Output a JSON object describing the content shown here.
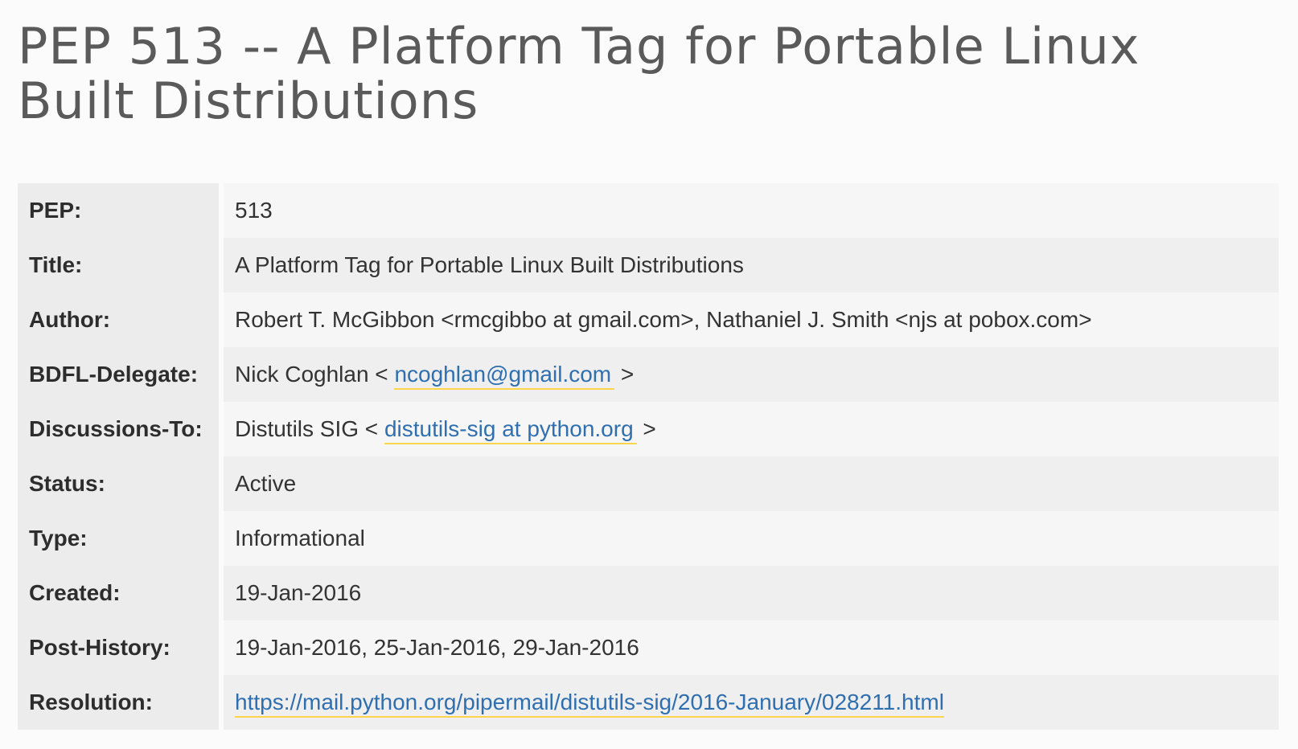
{
  "page": {
    "title": "PEP 513 -- A Platform Tag for Portable Linux Built Distributions"
  },
  "header_table": {
    "pep": {
      "label": "PEP:",
      "value": "513"
    },
    "title": {
      "label": "Title:",
      "value": "A Platform Tag for Portable Linux Built Distributions"
    },
    "author": {
      "label": "Author:",
      "value": "Robert T. McGibbon <rmcgibbo at gmail.com>, Nathaniel J. Smith <njs at pobox.com>"
    },
    "bdfl_delegate": {
      "label": "BDFL-Delegate:",
      "prefix": "Nick Coghlan < ",
      "link_text": "ncoghlan@gmail.com",
      "suffix": " >"
    },
    "discussions_to": {
      "label": "Discussions-To:",
      "prefix": "Distutils SIG < ",
      "link_text": "distutils-sig at python.org",
      "suffix": " >"
    },
    "status": {
      "label": "Status:",
      "value": "Active"
    },
    "type": {
      "label": "Type:",
      "value": "Informational"
    },
    "created": {
      "label": "Created:",
      "value": "19-Jan-2016"
    },
    "post_history": {
      "label": "Post-History:",
      "value": "19-Jan-2016, 25-Jan-2016, 29-Jan-2016"
    },
    "resolution": {
      "label": "Resolution:",
      "link_text": "https://mail.python.org/pipermail/distutils-sig/2016-January/028211.html"
    }
  },
  "colors": {
    "link": "#2f6fb0",
    "link_underline": "#ffd44d",
    "title_text": "#5a5a5a"
  }
}
